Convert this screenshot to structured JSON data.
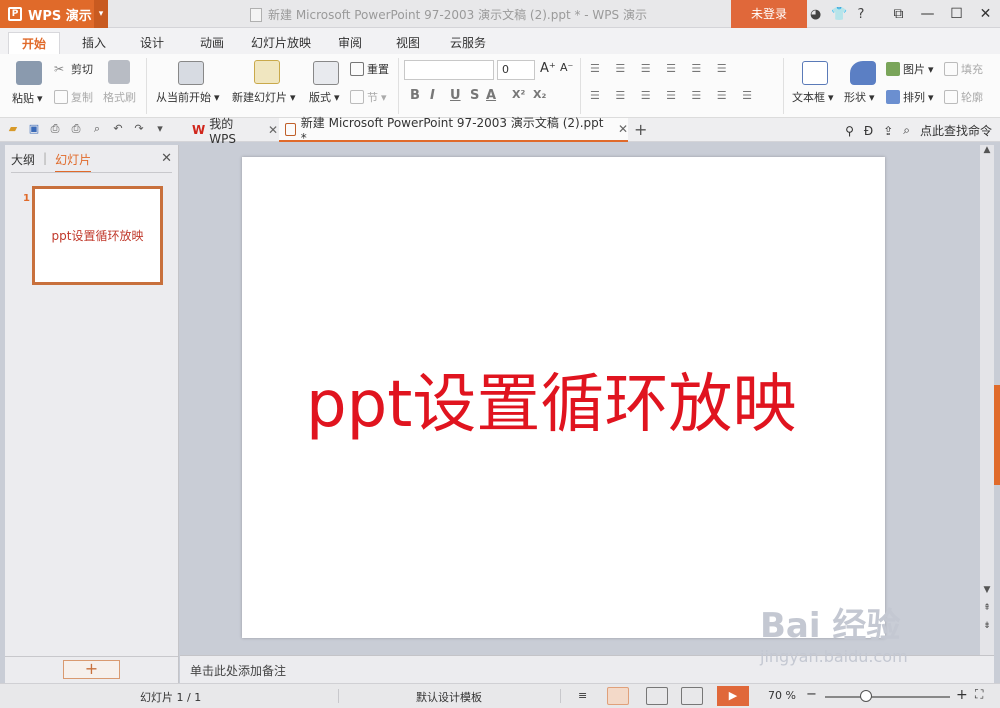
{
  "titlebar": {
    "app_name": "WPS 演示",
    "window_title": "新建 Microsoft PowerPoint 97-2003 演示文稿 (2).ppt * - WPS 演示",
    "login_label": "未登录",
    "help_label": "?"
  },
  "menu": {
    "tabs": [
      "开始",
      "插入",
      "设计",
      "动画",
      "幻灯片放映",
      "审阅",
      "视图",
      "云服务"
    ],
    "active_tab": "开始"
  },
  "ribbon": {
    "paste": "粘贴",
    "cut": "剪切",
    "copy": "复制",
    "format_painter": "格式刷",
    "from_current": "从当前开始",
    "new_slide": "新建幻灯片",
    "layout": "版式",
    "reset": "重置",
    "section": "节",
    "font_size": "0",
    "bold": "B",
    "italic": "I",
    "underline": "U",
    "strike": "S",
    "font_color": "A",
    "superscript": "X²",
    "subscript": "X₂",
    "grow_font": "A⁺",
    "shrink_font": "A⁻",
    "textbox": "文本框",
    "shape": "形状",
    "picture": "图片",
    "arrange": "排列",
    "fill": "填充",
    "outline": "轮廓"
  },
  "doc_tabs": {
    "home_tab": "我的WPS",
    "doc_tab": "新建 Microsoft PowerPoint 97-2003 演示文稿 (2).ppt *",
    "search_label": "点此查找命令"
  },
  "left_panel": {
    "tab_outline": "大纲",
    "tab_slides": "幻灯片",
    "slide_number": "1",
    "thumb_text": "ppt设置循环放映",
    "add_label": "+"
  },
  "slide": {
    "title": "ppt设置循环放映"
  },
  "notes": {
    "placeholder": "单击此处添加备注"
  },
  "statusbar": {
    "slide_count": "幻灯片 1 / 1",
    "template": "默认设计模板",
    "zoom": "70 %",
    "zoom_minus": "−",
    "zoom_plus": "+"
  },
  "watermark": {
    "line1": "Bai 经验",
    "line2": "jingyan.baidu.com"
  },
  "colors": {
    "accent": "#e06a2a",
    "title_red": "#e0141f"
  }
}
